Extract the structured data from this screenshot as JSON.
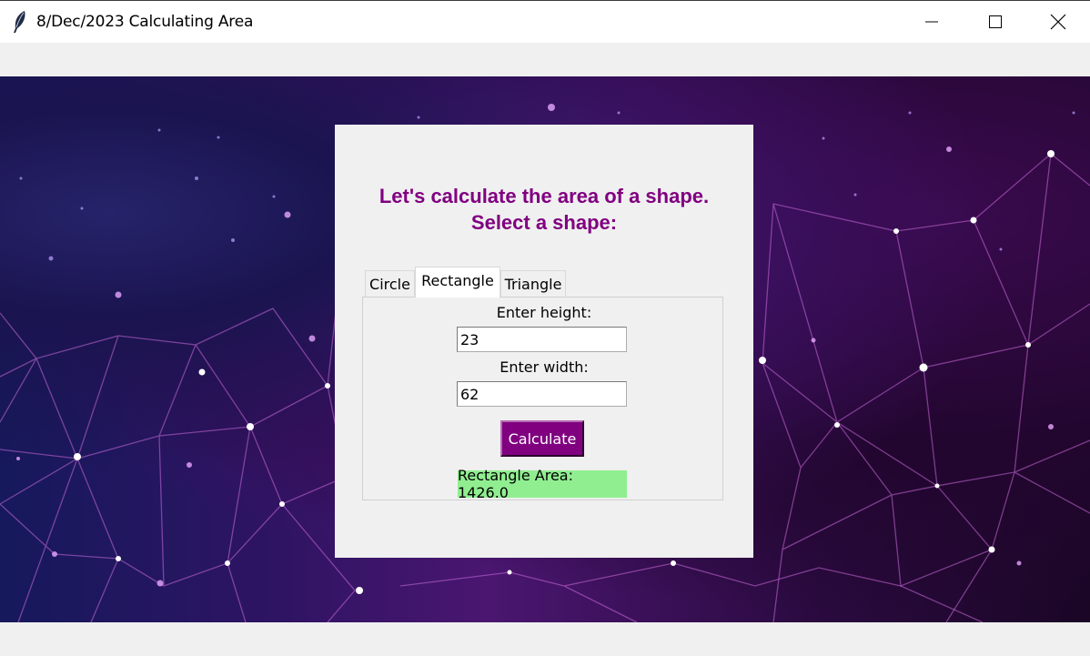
{
  "window": {
    "title": "8/Dec/2023 Calculating Area",
    "controls": [
      "minimize",
      "maximize",
      "close"
    ]
  },
  "panel": {
    "heading_line1": "Let's calculate the area of a shape.",
    "heading_line2": "Select a shape:",
    "tabs": [
      {
        "label": "Circle",
        "selected": false
      },
      {
        "label": "Rectangle",
        "selected": true
      },
      {
        "label": "Triangle",
        "selected": false
      }
    ],
    "form": {
      "height_label": "Enter height:",
      "height_value": "23",
      "width_label": "Enter width:",
      "width_value": "62",
      "calculate_label": "Calculate",
      "result_text": "Rectangle Area: 1426.0"
    }
  },
  "colors": {
    "accent": "#800080",
    "result_bg": "#90ee90",
    "panel_bg": "#f0f0f0"
  },
  "icons": [
    "feather-icon",
    "minimize-icon",
    "maximize-icon",
    "close-icon"
  ]
}
